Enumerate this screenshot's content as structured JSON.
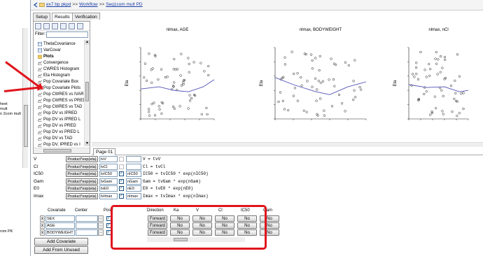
{
  "left_pane": {
    "fragments": [
      "heet",
      "mult",
      "n 2com mult",
      "rom PK"
    ]
  },
  "breadcrumb": {
    "items": [
      "ex7 bp pkpd",
      "Workflow",
      "Seq1com mult PD"
    ],
    "separator": ">>"
  },
  "tabs": [
    "Setup",
    "Results",
    "Verification"
  ],
  "active_tab": "Results",
  "tree": {
    "filter_label": "Filter:",
    "items": [
      {
        "label": "ThetaCovariance",
        "kind": "table"
      },
      {
        "label": "VarCovar",
        "kind": "table"
      },
      {
        "label": "Plots",
        "kind": "folder"
      },
      {
        "label": "Convergence",
        "kind": "plot"
      },
      {
        "label": "CWRES Histogram",
        "kind": "plot"
      },
      {
        "label": "Eta Histogram",
        "kind": "plot"
      },
      {
        "label": "Pop Covariate Box",
        "kind": "plot"
      },
      {
        "label": "Pop Covariate Plots",
        "kind": "plot"
      },
      {
        "label": "Pop CWRES vs IVAR",
        "kind": "plot"
      },
      {
        "label": "Pop CWRES vs PRED",
        "kind": "plot"
      },
      {
        "label": "Pop CWRES vs TAD",
        "kind": "plot"
      },
      {
        "label": "Pop DV vs IPRED",
        "kind": "plot"
      },
      {
        "label": "Pop DV vs IPRED L",
        "kind": "plot"
      },
      {
        "label": "Pop DV vs PRED",
        "kind": "plot"
      },
      {
        "label": "Pop DV vs PRED L",
        "kind": "plot"
      },
      {
        "label": "Pop DV vs TAD",
        "kind": "plot"
      },
      {
        "label": "Pop DV, IPRED vs I",
        "kind": "plot"
      }
    ]
  },
  "charts": [
    {
      "title": "nlmax, AGE",
      "ylabel": "Eta"
    },
    {
      "title": "nlmax, BODYWEIGHT",
      "ylabel": "Eta"
    },
    {
      "title": "nlmax, nCl",
      "ylabel": "Eta"
    }
  ],
  "page_tab": "Page 01",
  "parameters": [
    {
      "name": "V",
      "style": "Product*exp(eta)",
      "field": "tvV",
      "checked": false,
      "eta": "",
      "equation": "V = tvV"
    },
    {
      "name": "Cl",
      "style": "Product*exp(eta)",
      "field": "tvCl",
      "checked": false,
      "eta": "",
      "equation": "Cl = tvCl"
    },
    {
      "name": "IC50",
      "style": "Product*exp(eta)",
      "field": "tvIC50",
      "checked": true,
      "eta": "nIC50",
      "equation": "IC50 = tvIC50 * exp(nIC50)"
    },
    {
      "name": "Gam",
      "style": "Product*exp(eta)",
      "field": "tvGam",
      "checked": true,
      "eta": "nGam",
      "equation": "Gam = tvGam * exp(nGam)"
    },
    {
      "name": "E0",
      "style": "Product*exp(eta)",
      "field": "tvE0",
      "checked": true,
      "eta": "nE0",
      "equation": "E0 = tvE0 * exp(nE0)"
    },
    {
      "name": "Imax",
      "style": "Product*exp(eta)",
      "field": "tvImax",
      "checked": true,
      "eta": "nImax",
      "equation": "Imax = tvImax * exp(nImax)"
    }
  ],
  "covariates": {
    "headers": {
      "covariate": "Covariate",
      "center": "Center",
      "pos": "Pos?"
    },
    "rows": [
      {
        "remove": "x",
        "name": "SEX"
      },
      {
        "remove": "x",
        "name": "AGE"
      },
      {
        "remove": "x",
        "name": "BODYWEIGHT"
      }
    ],
    "add_button": "Add Covariate",
    "add_unused_button": "Add From Unused"
  },
  "effects_grid": {
    "headers": [
      "Direction",
      "Ka",
      "V",
      "Cl",
      "IC50",
      "Gam"
    ],
    "rows": [
      [
        "Forward",
        "No",
        "No",
        "No",
        "No",
        "No"
      ],
      [
        "Forward",
        "No",
        "No",
        "No",
        "No",
        "No"
      ],
      [
        "Forward",
        "No",
        "No",
        "No",
        "No",
        "No"
      ]
    ]
  },
  "colors": {
    "highlight": "#e0141c",
    "link": "#1a3fa8",
    "trend": "#5050b8"
  }
}
